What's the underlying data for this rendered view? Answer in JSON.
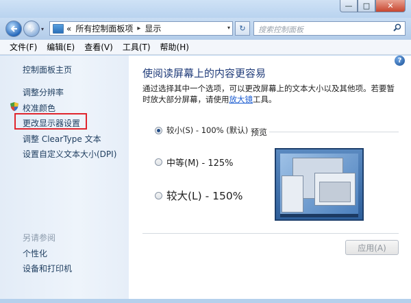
{
  "window": {
    "minimize_glyph": "—",
    "maximize_glyph": "□",
    "close_glyph": "✕"
  },
  "address_bar": {
    "history_glyph": "▾",
    "prefix": "«",
    "crumbs": [
      "所有控制面板项",
      "显示"
    ],
    "separator": "▸",
    "dropdown_glyph": "▾",
    "refresh_glyph": "↻"
  },
  "search": {
    "placeholder": "搜索控制面板"
  },
  "menu": [
    "文件(F)",
    "编辑(E)",
    "查看(V)",
    "工具(T)",
    "帮助(H)"
  ],
  "sidebar": {
    "home": "控制面板主页",
    "links": [
      "调整分辨率",
      "校准颜色",
      "更改显示器设置",
      "调整 ClearType 文本",
      "设置自定义文本大小(DPI)"
    ],
    "see_also_title": "另请参阅",
    "see_also_links": [
      "个性化",
      "设备和打印机"
    ]
  },
  "main": {
    "help_glyph": "?",
    "heading": "使阅读屏幕上的内容更容易",
    "desc_before": "通过选择其中一个选项，可以更改屏幕上的文本大小以及其他项。若要暂时放大部分屏幕，请使用",
    "desc_link": "放大镜",
    "desc_after": "工具。",
    "options": [
      {
        "label": "较小(S) - 100% (默认)",
        "selected": true
      },
      {
        "label": "中等(M) - 125%",
        "selected": false
      },
      {
        "label": "较大(L) - 150%",
        "selected": false
      }
    ],
    "preview_label": "预览",
    "apply_label": "应用(A)"
  }
}
